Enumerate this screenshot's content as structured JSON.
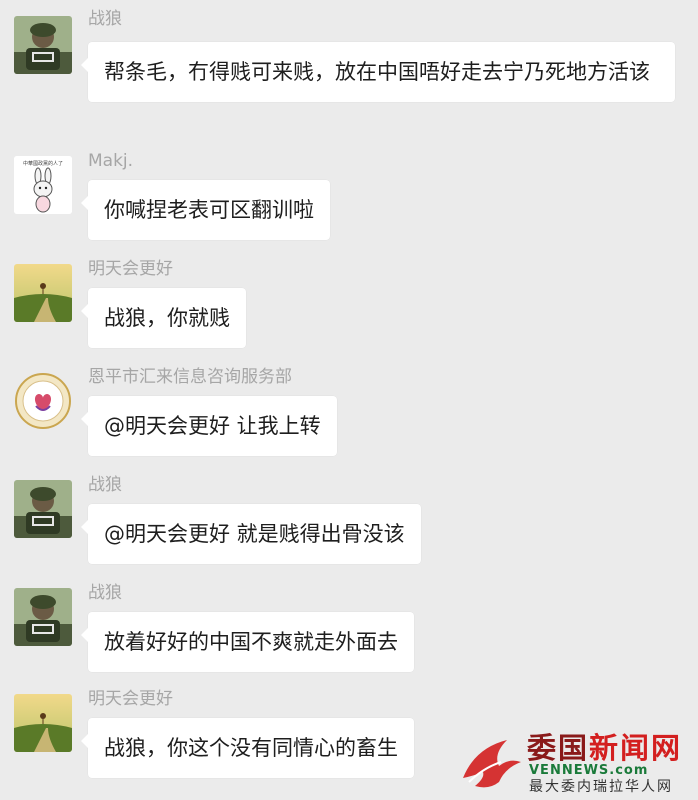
{
  "messages": [
    {
      "sender": "战狼",
      "avatar": "soldier-avatar",
      "text": "帮条毛，冇得贱可来贱，放在中国唔好走去宁乃死地方活该"
    },
    {
      "sender": "Makj.",
      "avatar": "rabbit-avatar",
      "avatar_caption": "中華國政黨的人了",
      "text": "你喊捏老表可区翻训啦"
    },
    {
      "sender": "明天会更好",
      "avatar": "landscape-avatar",
      "text": "战狼，你就贱"
    },
    {
      "sender": "恩平市汇来信息咨询服务部",
      "avatar": "emblem-avatar",
      "text": "@明天会更好 让我上转"
    },
    {
      "sender": "战狼",
      "avatar": "soldier-avatar",
      "text": "@明天会更好 就是贱得出骨没该"
    },
    {
      "sender": "战狼",
      "avatar": "soldier-avatar",
      "text": "放着好好的中国不爽就走外面去"
    },
    {
      "sender": "明天会更好",
      "avatar": "landscape-avatar",
      "text": "战狼，你这个没有同情心的畜生"
    }
  ],
  "watermark": {
    "title_part1": "委国",
    "title_part2": "新闻网",
    "domain": "VENNEWS.com",
    "subtitle": "最大委内瑞拉华人网",
    "colors": {
      "red": "#d31f1f",
      "dark": "#8a1a1a",
      "green": "#1a7a3a"
    }
  },
  "colors": {
    "background": "#ebebeb",
    "bubble": "#ffffff",
    "sender_name": "#a6a6a6"
  }
}
